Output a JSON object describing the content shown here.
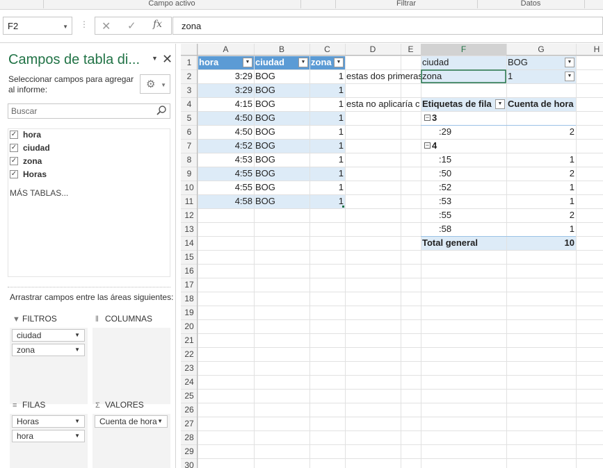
{
  "ribbon": {
    "groups": [
      "Campo activo",
      "Filtrar",
      "Datos"
    ]
  },
  "formula_bar": {
    "name_box": "F2",
    "formula": "zona"
  },
  "pane": {
    "title": "Campos de tabla di...",
    "subtitle": "Seleccionar campos para agregar al informe:",
    "search_placeholder": "Buscar",
    "fields": [
      {
        "label": "hora",
        "checked": true
      },
      {
        "label": "ciudad",
        "checked": true
      },
      {
        "label": "zona",
        "checked": true
      },
      {
        "label": "Horas",
        "checked": true
      }
    ],
    "more_tables": "MÁS TABLAS...",
    "drag_hint": "Arrastrar campos entre las áreas siguientes:",
    "areas": {
      "filters": {
        "label": "FILTROS",
        "items": [
          "ciudad",
          "zona"
        ]
      },
      "columns": {
        "label": "COLUMNAS",
        "items": []
      },
      "rows": {
        "label": "FILAS",
        "items": [
          "Horas",
          "hora"
        ]
      },
      "values": {
        "label": "VALORES",
        "items": [
          "Cuenta de hora"
        ]
      }
    }
  },
  "sheet": {
    "columns": [
      "A",
      "B",
      "C",
      "D",
      "E",
      "F",
      "G",
      "H"
    ],
    "row_count": 30,
    "selected_cell": "F2",
    "table": {
      "headers": [
        "hora",
        "ciudad",
        "zona"
      ],
      "rows": [
        [
          "3:29",
          "BOG",
          "1"
        ],
        [
          "3:29",
          "BOG",
          "1"
        ],
        [
          "4:15",
          "BOG",
          "1"
        ],
        [
          "4:50",
          "BOG",
          "1"
        ],
        [
          "4:50",
          "BOG",
          "1"
        ],
        [
          "4:52",
          "BOG",
          "1"
        ],
        [
          "4:53",
          "BOG",
          "1"
        ],
        [
          "4:55",
          "BOG",
          "1"
        ],
        [
          "4:55",
          "BOG",
          "1"
        ],
        [
          "4:58",
          "BOG",
          "1"
        ]
      ]
    },
    "notes": {
      "d2": "estas dos primeras",
      "d4": "esta no aplicaría c"
    },
    "pivot": {
      "filters": [
        {
          "field": "ciudad",
          "value": "BOG"
        },
        {
          "field": "zona",
          "value": "1"
        }
      ],
      "row_header": "Etiquetas de fila",
      "value_header": "Cuenta de hora",
      "groups": [
        {
          "label": "3",
          "items": [
            {
              "label": ":29",
              "value": "2"
            }
          ]
        },
        {
          "label": "4",
          "items": [
            {
              "label": ":15",
              "value": "1"
            },
            {
              "label": ":50",
              "value": "2"
            },
            {
              "label": ":52",
              "value": "1"
            },
            {
              "label": ":53",
              "value": "1"
            },
            {
              "label": ":55",
              "value": "2"
            },
            {
              "label": ":58",
              "value": "1"
            }
          ]
        }
      ],
      "total_label": "Total general",
      "total_value": "10"
    }
  },
  "colors": {
    "accent": "#217346",
    "table_header": "#5b9bd5",
    "band": "#ddebf7",
    "pivot_band": "#ddebf7",
    "header_bg": "#f3f3f3",
    "gridline": "#e1e1e1"
  }
}
